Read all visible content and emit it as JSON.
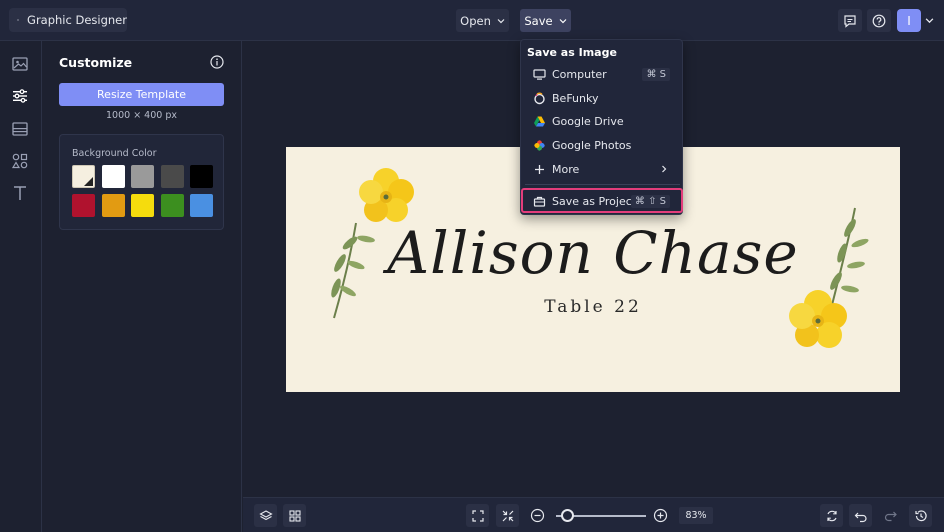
{
  "app": {
    "title": "Graphic Designer"
  },
  "toolbar": {
    "open_label": "Open",
    "save_label": "Save",
    "avatar_initial": "I"
  },
  "panel": {
    "title": "Customize",
    "resize_label": "Resize Template",
    "size_text": "1000 × 400 px",
    "bg_label": "Background Color",
    "swatches": [
      "#f5efe0",
      "#ffffff",
      "#9a9a9a",
      "#4a4a4a",
      "#000000",
      "#b0122e",
      "#e29b12",
      "#f5dc0d",
      "#3c8f1f",
      "#4a90e2"
    ]
  },
  "canvas": {
    "name": "Allison Chase",
    "table": "Table 22",
    "background": "#f6f0e0"
  },
  "save_menu": {
    "heading": "Save as Image",
    "items": [
      {
        "label": "Computer",
        "shortcut": "⌘ S",
        "icon": "monitor-icon"
      },
      {
        "label": "BeFunky",
        "shortcut": "",
        "icon": "befunky-icon"
      },
      {
        "label": "Google Drive",
        "shortcut": "",
        "icon": "google-drive-icon"
      },
      {
        "label": "Google Photos",
        "shortcut": "",
        "icon": "google-photos-icon"
      },
      {
        "label": "More",
        "shortcut": "",
        "icon": "plus-icon"
      }
    ],
    "project": {
      "label": "Save as Project",
      "shortcut": "⌘ ⇧ S"
    }
  },
  "bottom": {
    "zoom": "83%"
  },
  "colors": {
    "accent": "#7f8ef5",
    "highlight": "#e33d7b",
    "bg": "#1d2130"
  }
}
